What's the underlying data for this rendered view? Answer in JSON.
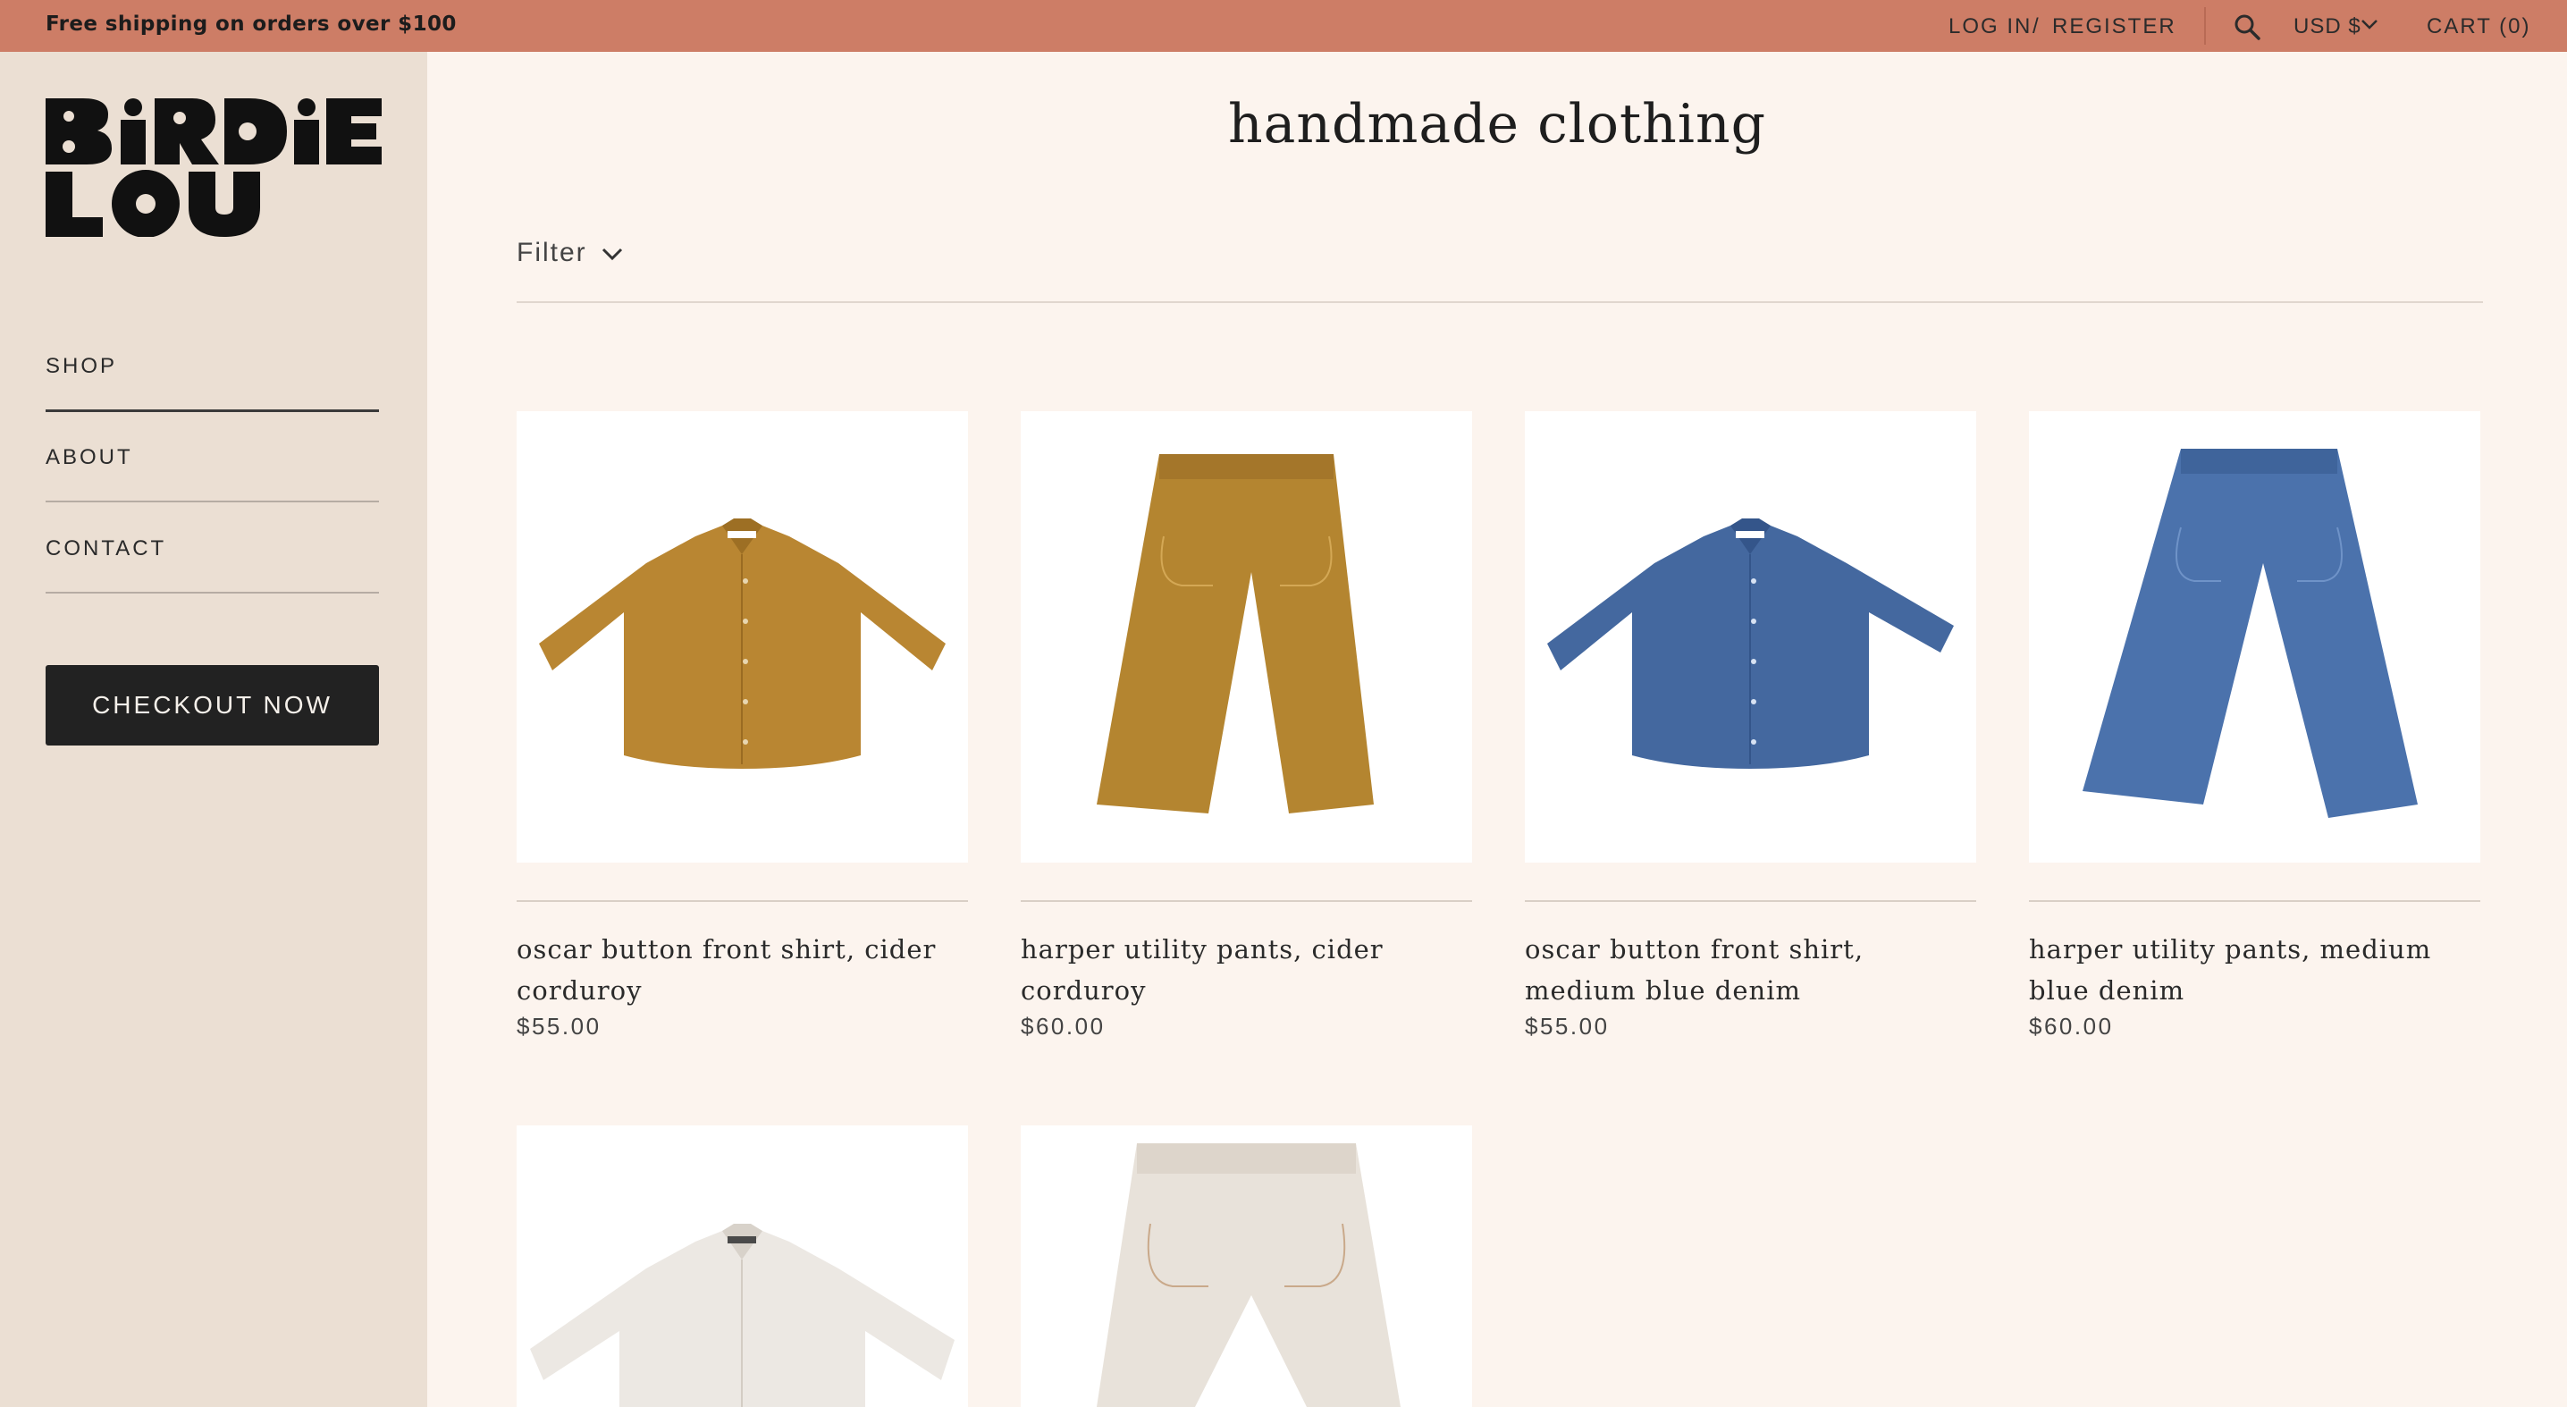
{
  "announcement": "Free shipping on orders over $100",
  "header": {
    "login": "LOG IN",
    "separator": "/",
    "register": "REGISTER",
    "currency": "USD $",
    "cart": "CART (0)"
  },
  "brand": {
    "logo_text": "BiRDiE LOU"
  },
  "nav": [
    {
      "label": "SHOP"
    },
    {
      "label": "ABOUT"
    },
    {
      "label": "CONTACT"
    }
  ],
  "checkout_label": "CHECKOUT NOW",
  "page_title": "handmade clothing",
  "filter_label": "Filter",
  "products": [
    {
      "name": "oscar button front shirt, cider corduroy",
      "price": "$55.00",
      "color": "#b98632"
    },
    {
      "name": "harper utility pants, cider corduroy",
      "price": "$60.00",
      "color": "#b48530"
    },
    {
      "name": "oscar button front shirt, medium blue denim",
      "price": "$55.00",
      "color": "#44689f"
    },
    {
      "name": "harper utility pants, medium blue denim",
      "price": "$60.00",
      "color": "#4b72ac"
    },
    {
      "name": "",
      "price": "",
      "color": "#ece8e3"
    },
    {
      "name": "",
      "price": "",
      "color": "#e8e2da"
    }
  ],
  "colors": {
    "topbar": "#cd7d66",
    "sidebar": "#ebdfd3",
    "page": "#fcf4ee",
    "button": "#222222"
  }
}
